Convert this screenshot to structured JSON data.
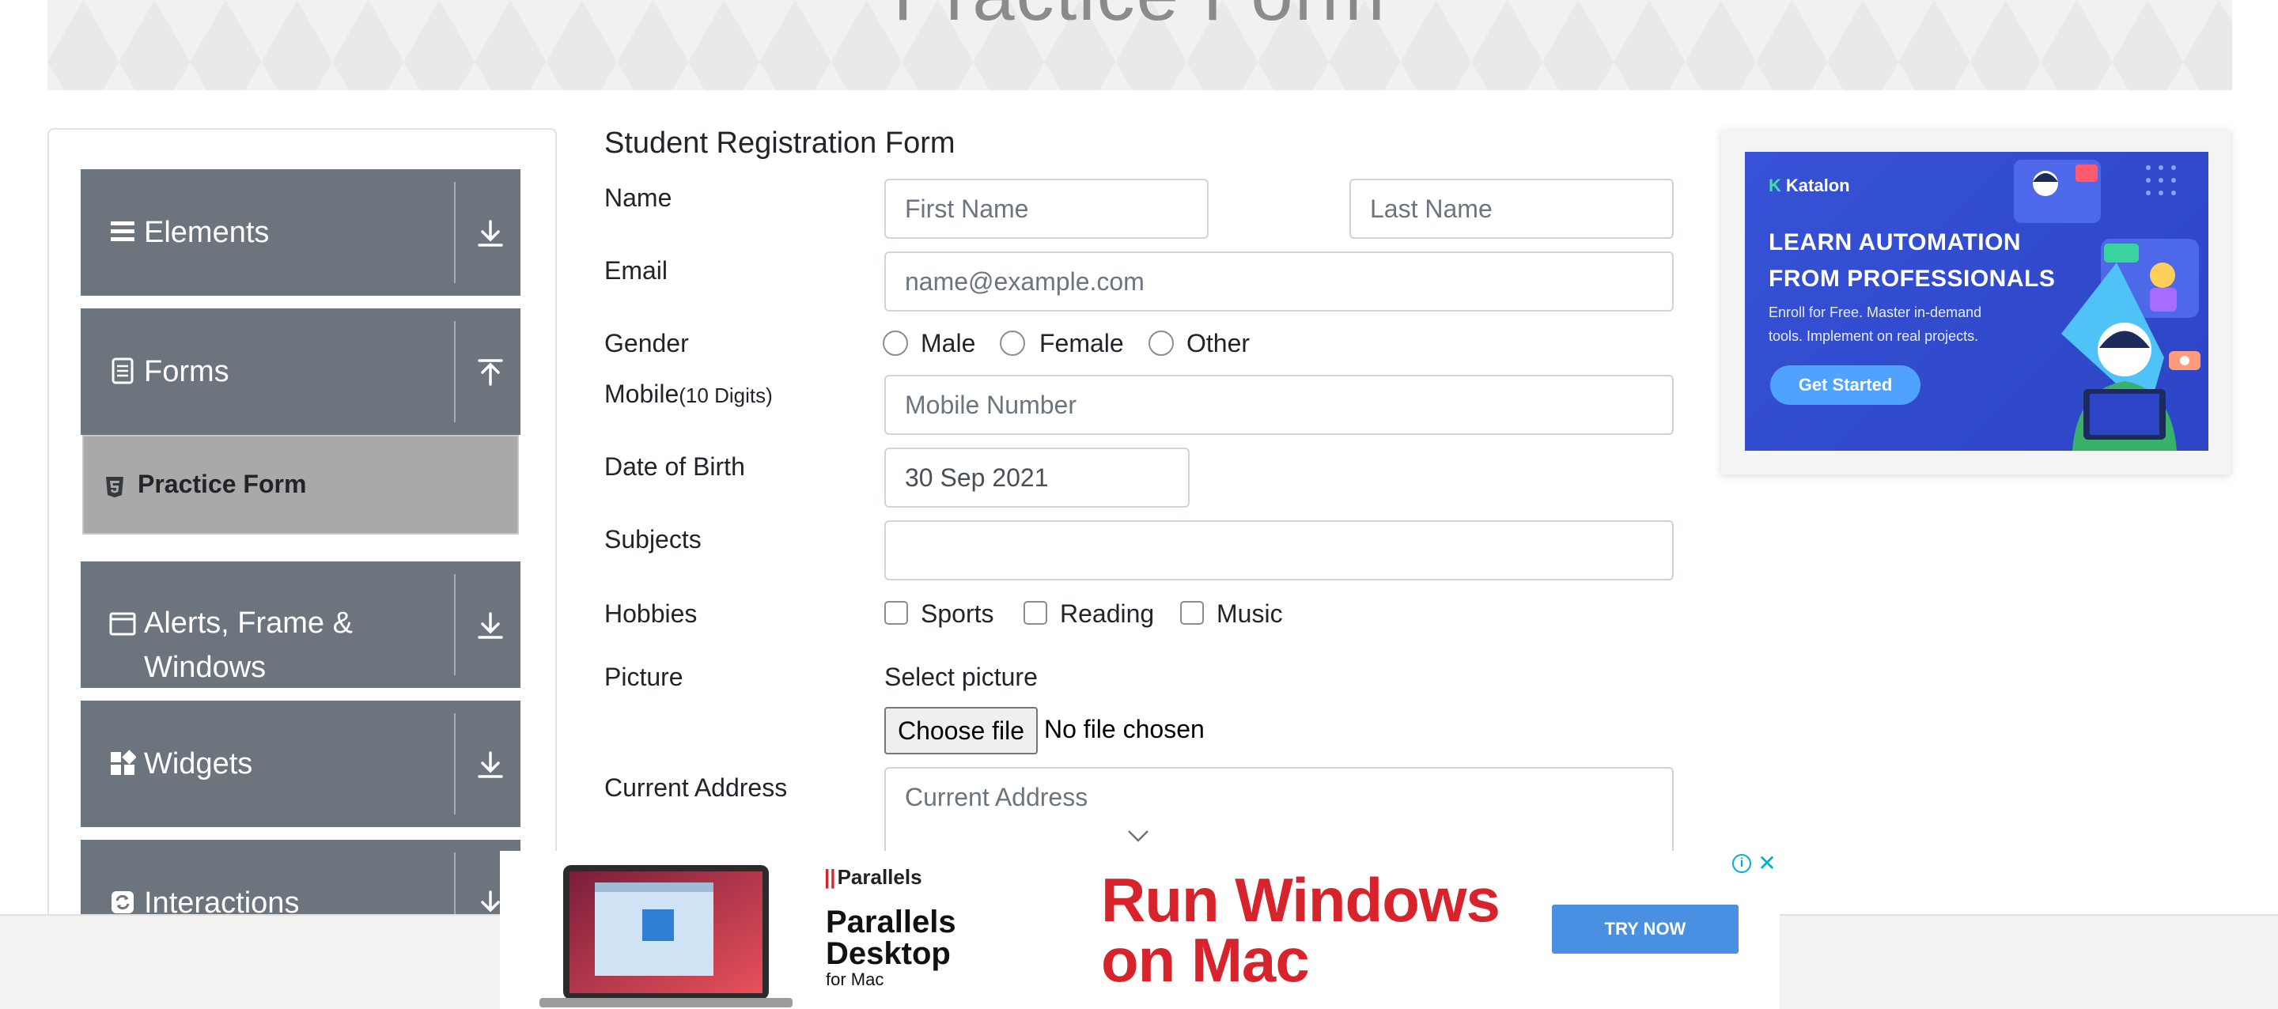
{
  "banner": {
    "title": "Practice Form"
  },
  "sidebar": {
    "groups": [
      {
        "label": "Elements",
        "icon": "hamburger-icon",
        "arrow": "download-arrow-icon"
      },
      {
        "label": "Forms",
        "icon": "document-icon",
        "arrow": "upload-arrow-icon"
      },
      {
        "label": "Alerts, Frame & Windows",
        "line1": "Alerts, Frame &",
        "line2": "Windows",
        "icon": "window-icon",
        "arrow": "download-arrow-icon"
      },
      {
        "label": "Widgets",
        "icon": "widgets-icon",
        "arrow": "download-arrow-icon"
      },
      {
        "label": "Interactions",
        "icon": "interactions-icon",
        "arrow": "download-arrow-icon"
      }
    ],
    "active_item": {
      "label": "Practice Form",
      "icon": "html5-icon"
    }
  },
  "form": {
    "title": "Student Registration Form",
    "name_label": "Name",
    "first_name_placeholder": "First Name",
    "last_name_placeholder": "Last Name",
    "email_label": "Email",
    "email_placeholder": "name@example.com",
    "gender_label": "Gender",
    "gender_options": [
      "Male",
      "Female",
      "Other"
    ],
    "mobile_label": "Mobile",
    "mobile_hint": "(10 Digits)",
    "mobile_placeholder": "Mobile Number",
    "dob_label": "Date of Birth",
    "dob_value": "30 Sep 2021",
    "subjects_label": "Subjects",
    "subjects_value": "",
    "hobbies_label": "Hobbies",
    "hobby_options": [
      "Sports",
      "Reading",
      "Music"
    ],
    "picture_label": "Picture",
    "select_picture": "Select picture",
    "choose_file": "Choose file",
    "file_status": "No file chosen",
    "address_label": "Current Address",
    "address_placeholder": "Current Address"
  },
  "side_ad": {
    "brand": "Katalon",
    "headline_1": "LEARN AUTOMATION",
    "headline_2": "FROM PROFESSIONALS",
    "subtext_1": "Enroll for Free. Master in-demand",
    "subtext_2": "tools. Implement on real projects.",
    "cta": "Get Started"
  },
  "bottom_ad": {
    "brand": "Parallels",
    "product_1": "Parallels",
    "product_2": "Desktop",
    "product_3": "for Mac",
    "headline_1": "Run Windows",
    "headline_2": "on Mac",
    "cta": "TRY NOW",
    "info_glyph": "i",
    "close_glyph": "✕"
  },
  "colors": {
    "sidebar_group_bg": "#6c757d",
    "active_item_bg": "#a9a9a9",
    "katalon_blue": "#3752d6",
    "parallels_red": "#d7242c",
    "try_now_blue": "#4a90e2"
  }
}
